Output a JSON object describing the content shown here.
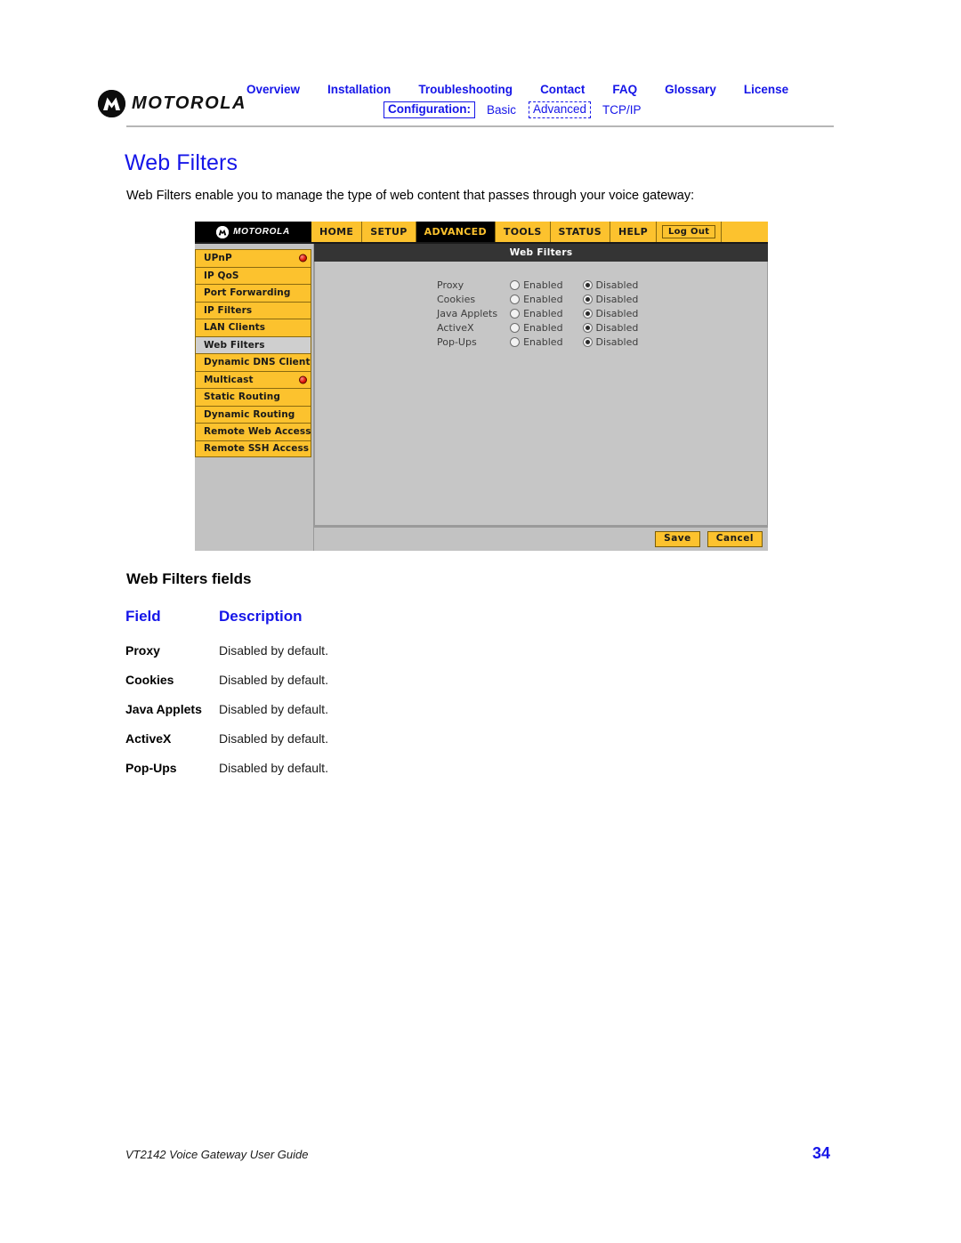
{
  "header": {
    "brand": "MOTOROLA",
    "nav_primary": [
      {
        "label": "Overview"
      },
      {
        "label": "Installation"
      },
      {
        "label": "Troubleshooting"
      },
      {
        "label": "Contact"
      },
      {
        "label": "FAQ"
      },
      {
        "label": "Glossary"
      },
      {
        "label": "License"
      }
    ],
    "nav_secondary": {
      "config_label": "Configuration:",
      "basic": "Basic",
      "advanced": "Advanced",
      "tcpip": "TCP/IP"
    }
  },
  "page": {
    "title": "Web Filters",
    "intro": "Web Filters enable you to manage the type of web content that passes through your voice gateway:"
  },
  "device": {
    "brand": "MOTOROLA",
    "tabs": [
      {
        "label": "HOME",
        "active": false
      },
      {
        "label": "SETUP",
        "active": false
      },
      {
        "label": "ADVANCED",
        "active": true
      },
      {
        "label": "TOOLS",
        "active": false
      },
      {
        "label": "STATUS",
        "active": false
      },
      {
        "label": "HELP",
        "active": false
      }
    ],
    "logout_label": "Log Out",
    "sidebar": [
      {
        "label": "UPnP",
        "led": true,
        "selected": false
      },
      {
        "label": "IP QoS",
        "led": false,
        "selected": false
      },
      {
        "label": "Port Forwarding",
        "led": false,
        "selected": false
      },
      {
        "label": "IP Filters",
        "led": false,
        "selected": false
      },
      {
        "label": "LAN Clients",
        "led": false,
        "selected": false
      },
      {
        "label": "Web Filters",
        "led": false,
        "selected": true
      },
      {
        "label": "Dynamic DNS Client",
        "led": false,
        "selected": false
      },
      {
        "label": "Multicast",
        "led": true,
        "selected": false
      },
      {
        "label": "Static Routing",
        "led": false,
        "selected": false
      },
      {
        "label": "Dynamic Routing",
        "led": false,
        "selected": false
      },
      {
        "label": "Remote Web Access",
        "led": false,
        "selected": false
      },
      {
        "label": "Remote SSH Access",
        "led": false,
        "selected": false
      }
    ],
    "panel_title": "Web Filters",
    "option_enabled": "Enabled",
    "option_disabled": "Disabled",
    "settings": [
      {
        "label": "Proxy",
        "value": "Disabled"
      },
      {
        "label": "Cookies",
        "value": "Disabled"
      },
      {
        "label": "Java Applets",
        "value": "Disabled"
      },
      {
        "label": "ActiveX",
        "value": "Disabled"
      },
      {
        "label": "Pop-Ups",
        "value": "Disabled"
      }
    ],
    "save_label": "Save",
    "cancel_label": "Cancel"
  },
  "fields_section": {
    "heading": "Web Filters fields",
    "columns": {
      "field": "Field",
      "description": "Description"
    },
    "rows": [
      {
        "field": "Proxy",
        "description": "Disabled by default."
      },
      {
        "field": "Cookies",
        "description": "Disabled by default."
      },
      {
        "field": "Java Applets",
        "description": "Disabled by default."
      },
      {
        "field": "ActiveX",
        "description": "Disabled by default."
      },
      {
        "field": "Pop-Ups",
        "description": "Disabled by default."
      }
    ]
  },
  "footer": {
    "guide": "VT2142 Voice Gateway User Guide",
    "page_number": "34"
  },
  "colors": {
    "link_blue": "#1515e8",
    "device_gold": "#fcc22e",
    "device_dark": "#343434",
    "led_red": "#e01a0d"
  }
}
